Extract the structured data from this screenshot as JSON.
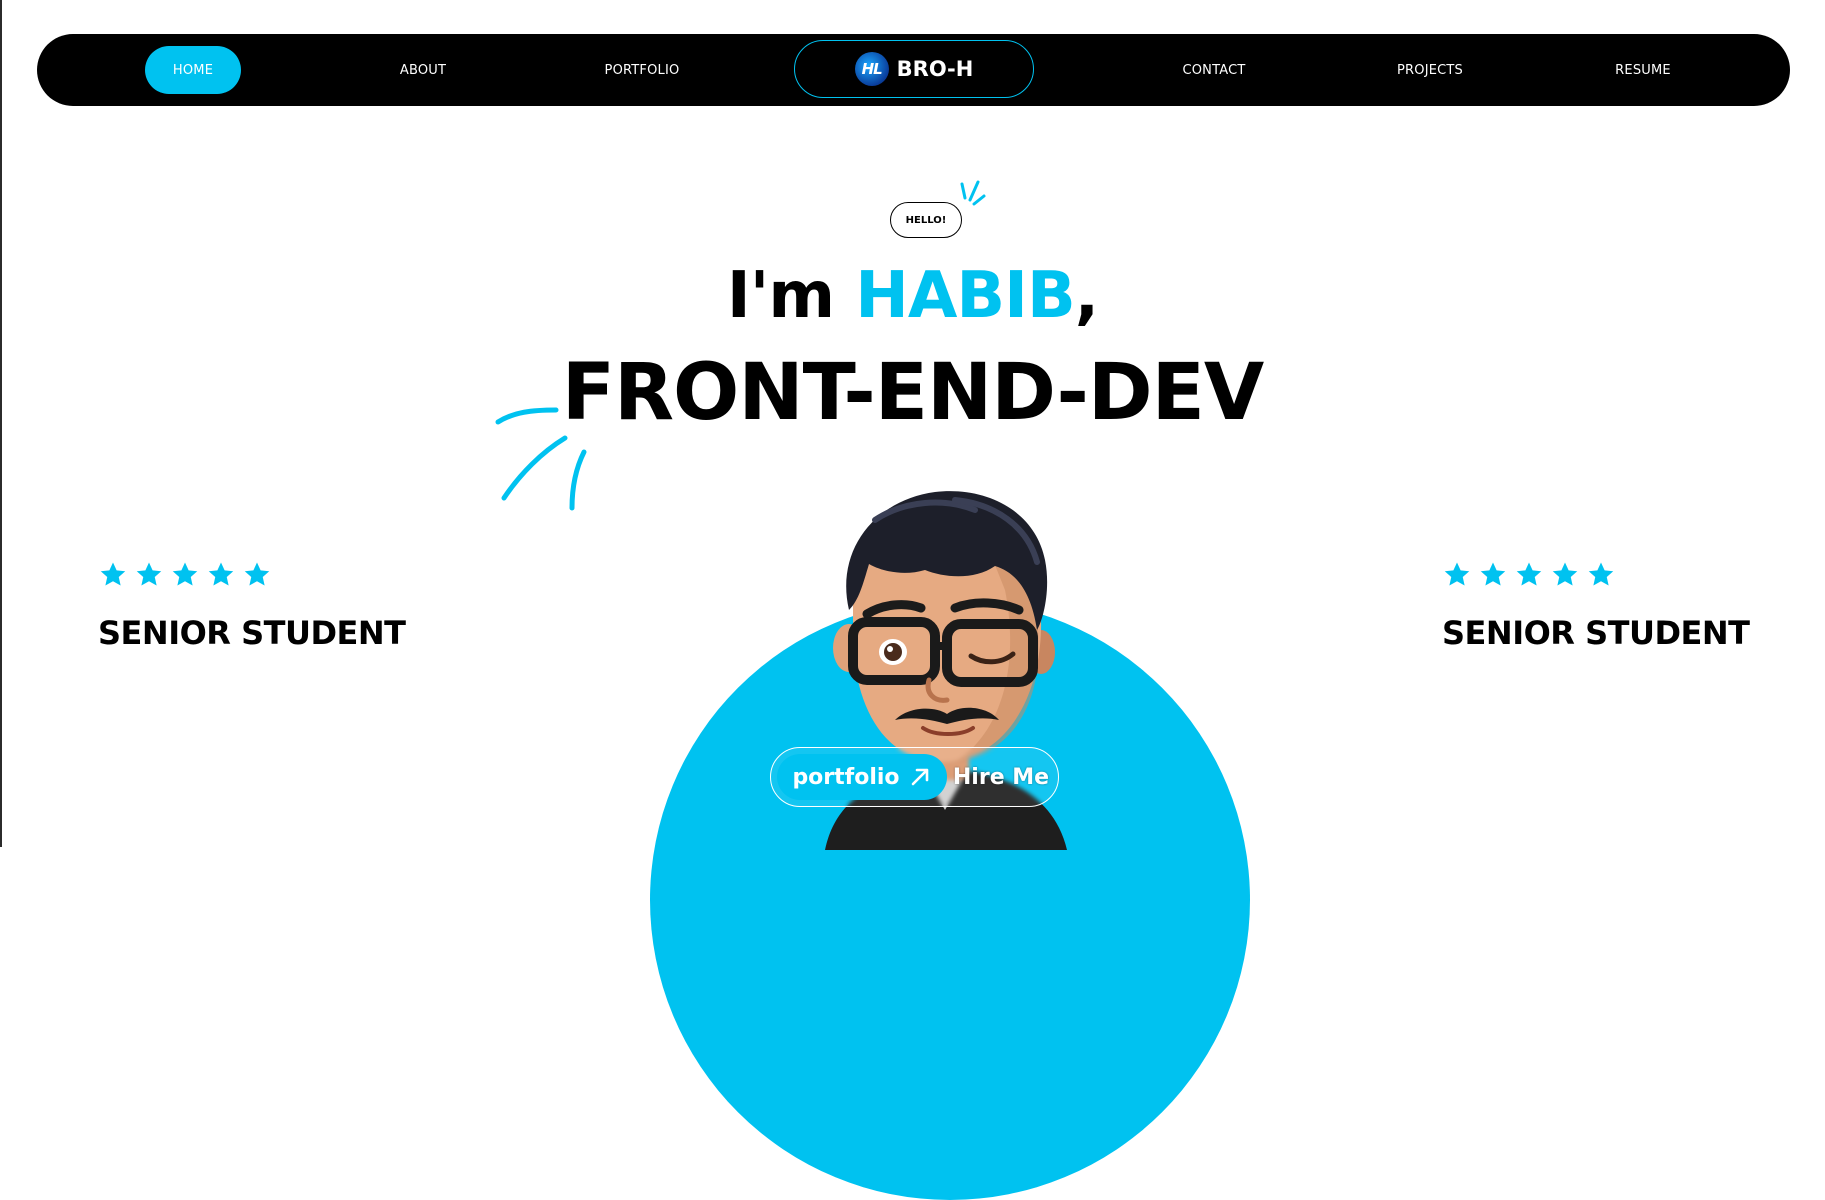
{
  "nav": {
    "items_left": [
      {
        "label": "HOME",
        "active": true
      },
      {
        "label": "ABOUT",
        "active": false
      },
      {
        "label": "PORTFOLIO",
        "active": false
      }
    ],
    "brand": {
      "logo_text": "HL",
      "name": "BRO-H"
    },
    "items_right": [
      {
        "label": "CONTACT",
        "active": false
      },
      {
        "label": "PROJECTS",
        "active": false
      },
      {
        "label": "RESUME",
        "active": false
      }
    ]
  },
  "hero": {
    "badge": "HELLO!",
    "line1_prefix": "I'm",
    "line1_name": "HABIB",
    "line1_suffix": ",",
    "line2": "FRONT-END-DEV"
  },
  "side_left": {
    "rating": 5,
    "label": "SENIOR STUDENT"
  },
  "side_right": {
    "rating": 5,
    "label": "SENIOR STUDENT"
  },
  "cta": {
    "primary_label": "portfolio",
    "primary_icon": "arrow-up-right-icon",
    "secondary_label": "Hire Me"
  },
  "colors": {
    "accent": "#00c2f0",
    "nav_bg": "#000000",
    "text": "#000000"
  }
}
